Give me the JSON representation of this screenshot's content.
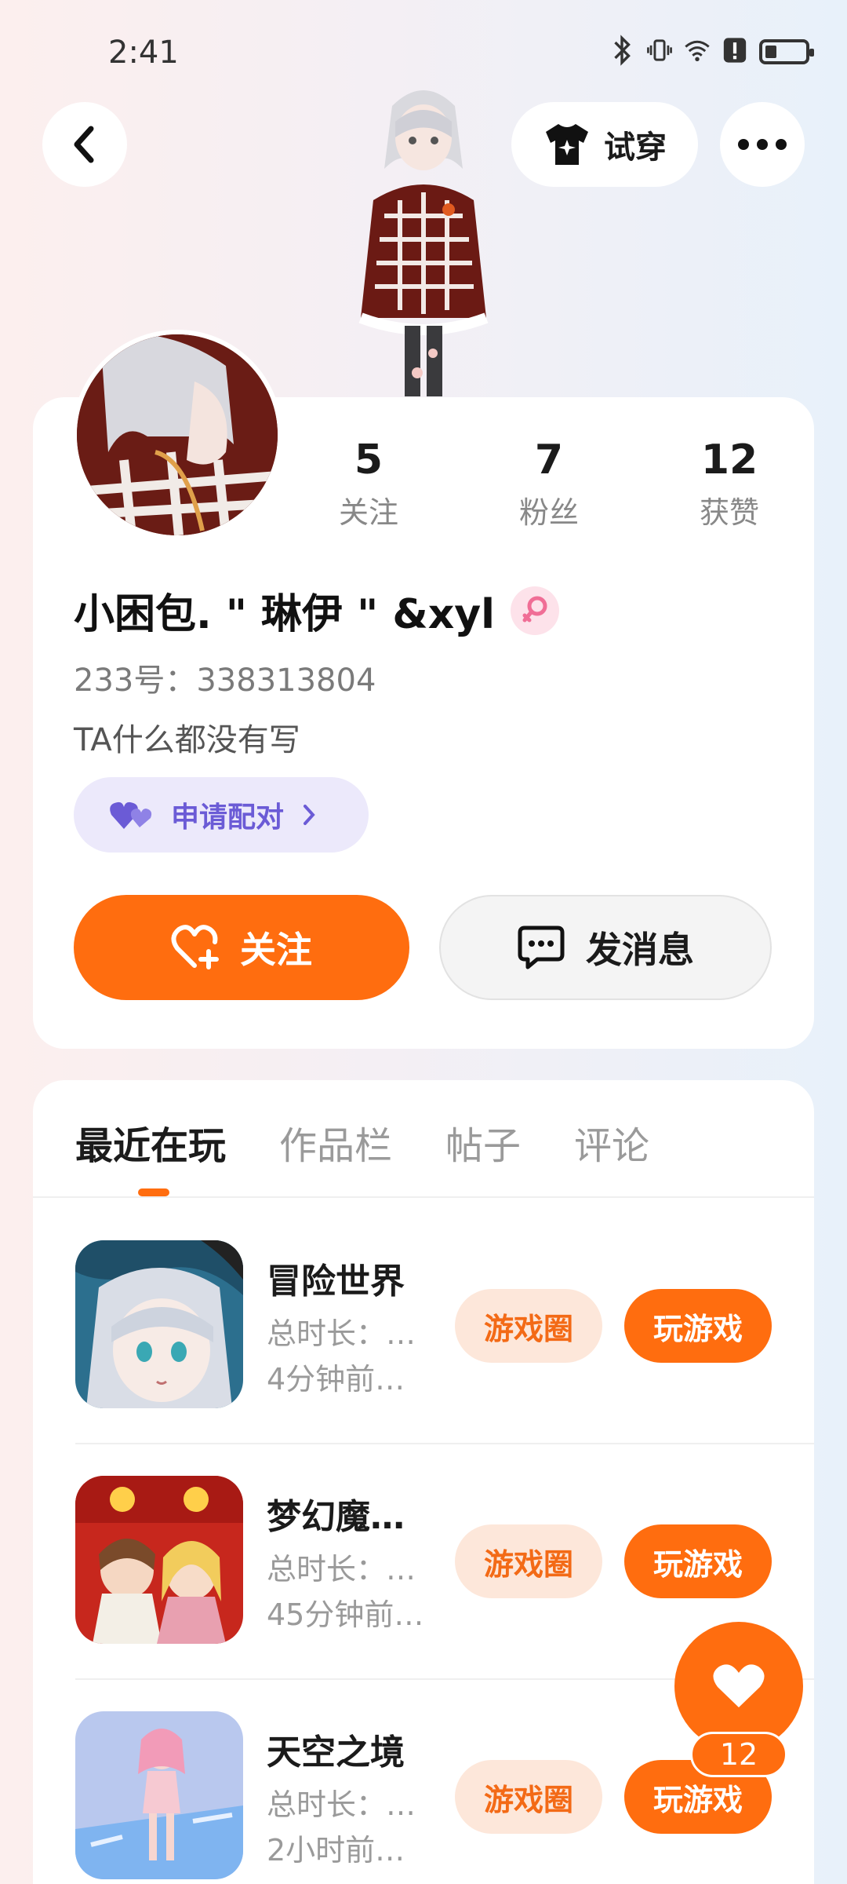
{
  "status_bar": {
    "time": "2:41"
  },
  "header": {
    "try_on_label": "试穿"
  },
  "profile": {
    "stats": [
      {
        "value": "5",
        "label": "关注"
      },
      {
        "value": "7",
        "label": "粉丝"
      },
      {
        "value": "12",
        "label": "获赞"
      }
    ],
    "username": "小困包. \" 琳伊 \" &xyl",
    "uid": "233号：338313804",
    "bio": "TA什么都没有写",
    "pair_label": "申请配对",
    "follow_label": "关注",
    "message_label": "发消息"
  },
  "tabs": [
    {
      "label": "最近在玩",
      "active": true
    },
    {
      "label": "作品栏",
      "active": false
    },
    {
      "label": "帖子",
      "active": false
    },
    {
      "label": "评论",
      "active": false
    }
  ],
  "games": [
    {
      "title": "冒险世界",
      "duration": "总时长：…",
      "last_played": "4分钟前…",
      "circle_label": "游戏圈",
      "play_label": "玩游戏"
    },
    {
      "title": "梦幻魔…",
      "duration": "总时长：…",
      "last_played": "45分钟前…",
      "circle_label": "游戏圈",
      "play_label": "玩游戏"
    },
    {
      "title": "天空之境",
      "duration": "总时长：…",
      "last_played": "2小时前…",
      "circle_label": "游戏圈",
      "play_label": "玩游戏"
    }
  ],
  "like": {
    "count": "12"
  },
  "colors": {
    "accent": "#ff6d0f",
    "pair_bg": "#ece9fb",
    "pair_text": "#6b5bd6"
  }
}
